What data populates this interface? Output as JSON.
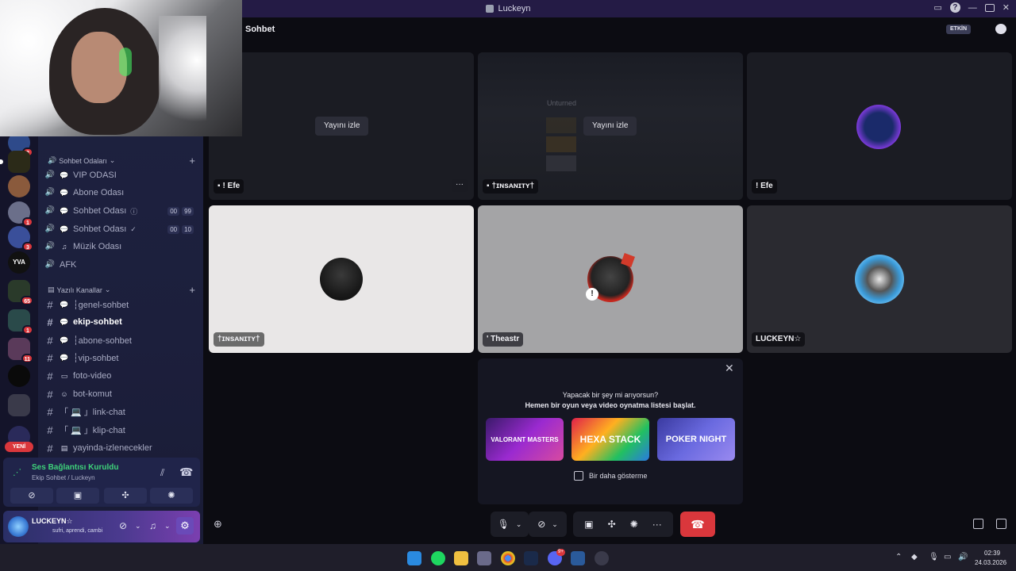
{
  "window": {
    "title": "Luckeyn"
  },
  "header": {
    "channel_title": "Sohbet",
    "activity_badge": "ETKİN"
  },
  "sidebar": {
    "voice_category": "Sohbet Odaları",
    "voice_channels": [
      {
        "label": "VIP ODASI"
      },
      {
        "label": "Abone Odası"
      },
      {
        "label": "Sohbet Odası",
        "count_a": "00",
        "count_b": "99"
      },
      {
        "label": "Sohbet Odası",
        "count_a": "00",
        "count_b": "10"
      },
      {
        "label": "Müzik Odası"
      },
      {
        "label": "AFK"
      }
    ],
    "text_category": "Yazılı Kanallar",
    "text_channels": [
      {
        "label": "┆genel-sohbet"
      },
      {
        "label": "ekip-sohbet"
      },
      {
        "label": "┆abone-sohbet"
      },
      {
        "label": "┆vip-sohbet"
      },
      {
        "label": "foto-video"
      },
      {
        "label": "bot-komut"
      },
      {
        "label": "「 💻 」link-chat"
      },
      {
        "label": "「 💻 」klip-chat"
      },
      {
        "label": "yayinda-izlenecekler"
      }
    ],
    "new_badge": "YENİ"
  },
  "servers": {
    "badges": [
      "2",
      "1",
      "3",
      "65",
      "1",
      "11"
    ]
  },
  "voice_panel": {
    "status": "Ses Bağlantısı Kuruldu",
    "location": "Ekip Sohbet / Luckeyn"
  },
  "user_panel": {
    "name": "LUCKEYN☆",
    "status": "sufri, aprendi, cambi"
  },
  "tiles": {
    "watch_label": "Yayını izle",
    "t1_name": "! Efe",
    "t2_name": "†ɪɴsᴀɴɪᴛʏ†",
    "t3_name": "! Efe",
    "t4_name": "†ɪɴsᴀɴɪᴛʏ†",
    "t5_name": "' Theastr",
    "t6_name": "LUCKEYN☆",
    "stream_preview_text": "Unturned"
  },
  "activity_popup": {
    "line1": "Yapacak bir şey mi arıyorsun?",
    "line2": "Hemen bir oyun veya video oynatma listesi başlat.",
    "games": [
      "VALORANT MASTERS",
      "HEXA STACK",
      "POKER NIGHT"
    ],
    "dont_show": "Bir daha gösterme"
  },
  "taskbar": {
    "time": "02:39",
    "date": "24.03.2026",
    "notif_badge": "9+"
  },
  "colors": {
    "accent": "#5865f2",
    "end_call": "#da373c",
    "connected_green": "#3ed27a",
    "title_bar": "#241b45"
  }
}
